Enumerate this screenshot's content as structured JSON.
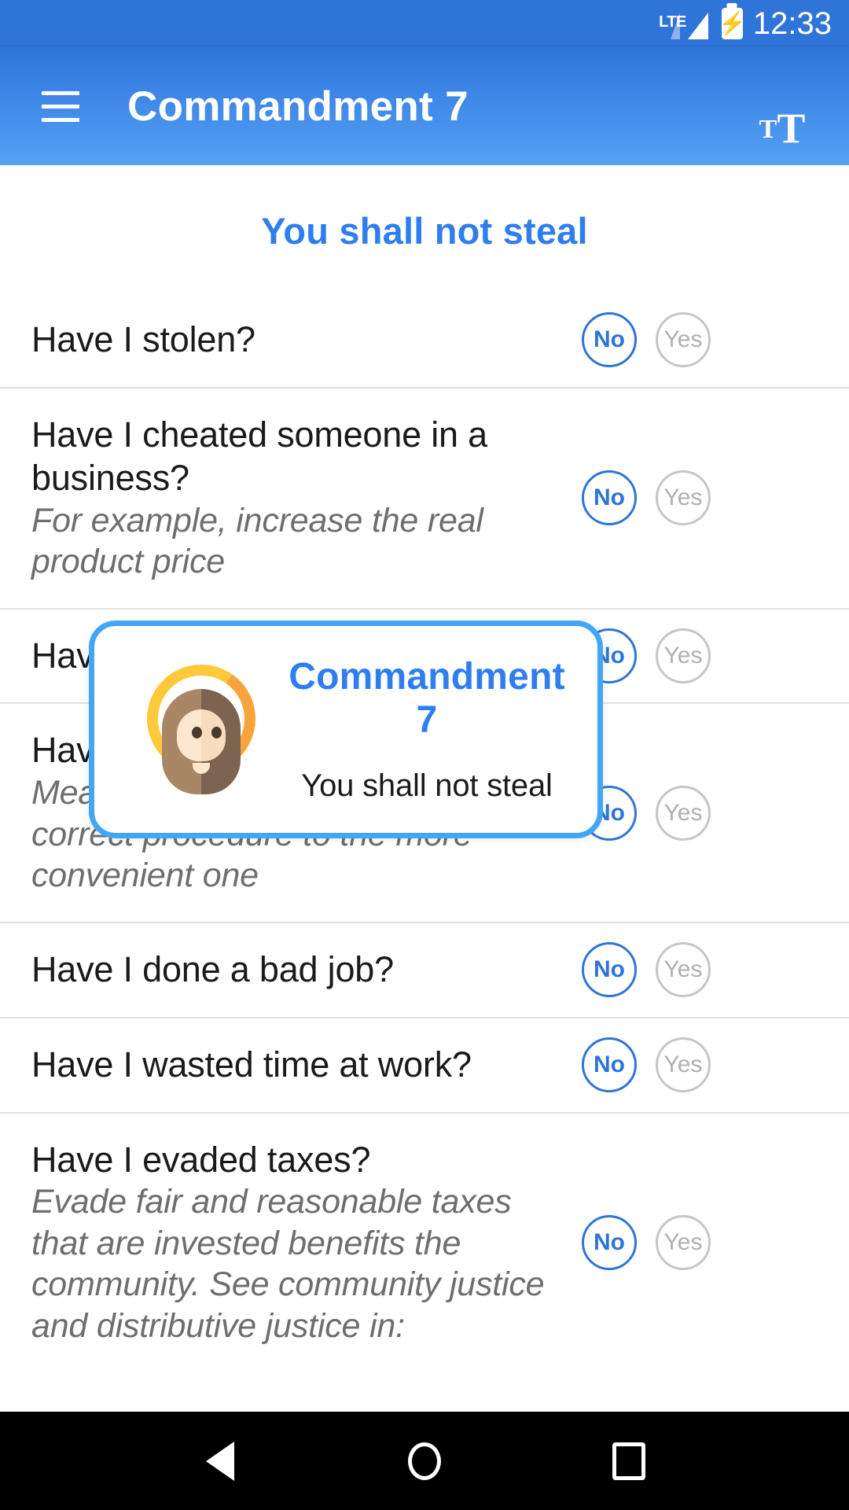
{
  "status_bar": {
    "network_label": "LTE",
    "time": "12:33",
    "battery_icon": "battery-charging-icon",
    "signal_icon": "signal-bars-icon"
  },
  "app_bar": {
    "title": "Commandment 7",
    "menu_icon": "hamburger-menu-icon",
    "font_size_icon": "text-size-icon",
    "font_size_small": "T",
    "font_size_large": "T"
  },
  "content": {
    "section_title": "You shall not steal",
    "answer_no": "No",
    "answer_yes": "Yes",
    "questions": [
      {
        "title": "Have I stolen?",
        "subtitle": "",
        "selected": "No"
      },
      {
        "title": "Have I cheated someone in a business?",
        "subtitle": "For example, increase the real product price",
        "selected": "No"
      },
      {
        "title": "Have",
        "subtitle": "",
        "selected": "No"
      },
      {
        "title": "Have",
        "subtitle": "Meaning that you change the correct procedure to the more convenient one",
        "selected": "No"
      },
      {
        "title": "Have I done a bad job?",
        "subtitle": "",
        "selected": "No"
      },
      {
        "title": "Have I wasted time at work?",
        "subtitle": "",
        "selected": "No"
      },
      {
        "title": "Have I evaded taxes?",
        "subtitle": "Evade fair and reasonable taxes that are invested benefits the community. See community justice and distributive justice in:",
        "selected": "No"
      }
    ]
  },
  "modal": {
    "title": "Commandment 7",
    "subtitle": "You shall not steal",
    "avatar_icon": "jesus-avatar-icon"
  },
  "nav_bar": {
    "back_icon": "back-triangle-icon",
    "home_icon": "home-circle-icon",
    "recents_icon": "recents-square-icon"
  },
  "colors": {
    "accent_blue": "#2f7ef0",
    "app_bar_blue": "#3f88e8",
    "modal_border": "#42a5f5",
    "halo_yellow": "#ffc93c",
    "halo_orange": "#f9a43a"
  }
}
